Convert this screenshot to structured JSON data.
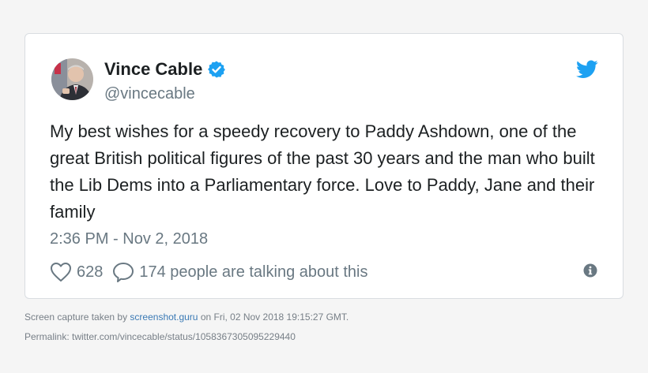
{
  "tweet": {
    "author": {
      "name": "Vince Cable",
      "handle": "@vincecable",
      "verified": true
    },
    "text": "My best wishes for a speedy recovery to Paddy Ashdown, one of the great British political figures of the past 30 years and the man who built the Lib Dems into a Parliamentary force. Love to Paddy, Jane and their family",
    "timestamp": "2:36 PM - Nov 2, 2018",
    "likes": "628",
    "conversation": "174 people are talking about this"
  },
  "footer": {
    "capture_prefix": "Screen capture taken by ",
    "capture_link": "screenshot.guru",
    "capture_suffix": " on Fri, 02 Nov 2018 19:15:27 GMT.",
    "permalink": "Permalink: twitter.com/vincecable/status/1058367305095229440"
  },
  "colors": {
    "twitter_blue": "#1da1f2",
    "muted_text": "#697882",
    "body_text": "#1c2022",
    "link": "#3b7ab5"
  },
  "icons": [
    "verified-badge-icon",
    "twitter-bird-icon",
    "heart-icon",
    "speech-bubble-icon",
    "info-icon"
  ]
}
